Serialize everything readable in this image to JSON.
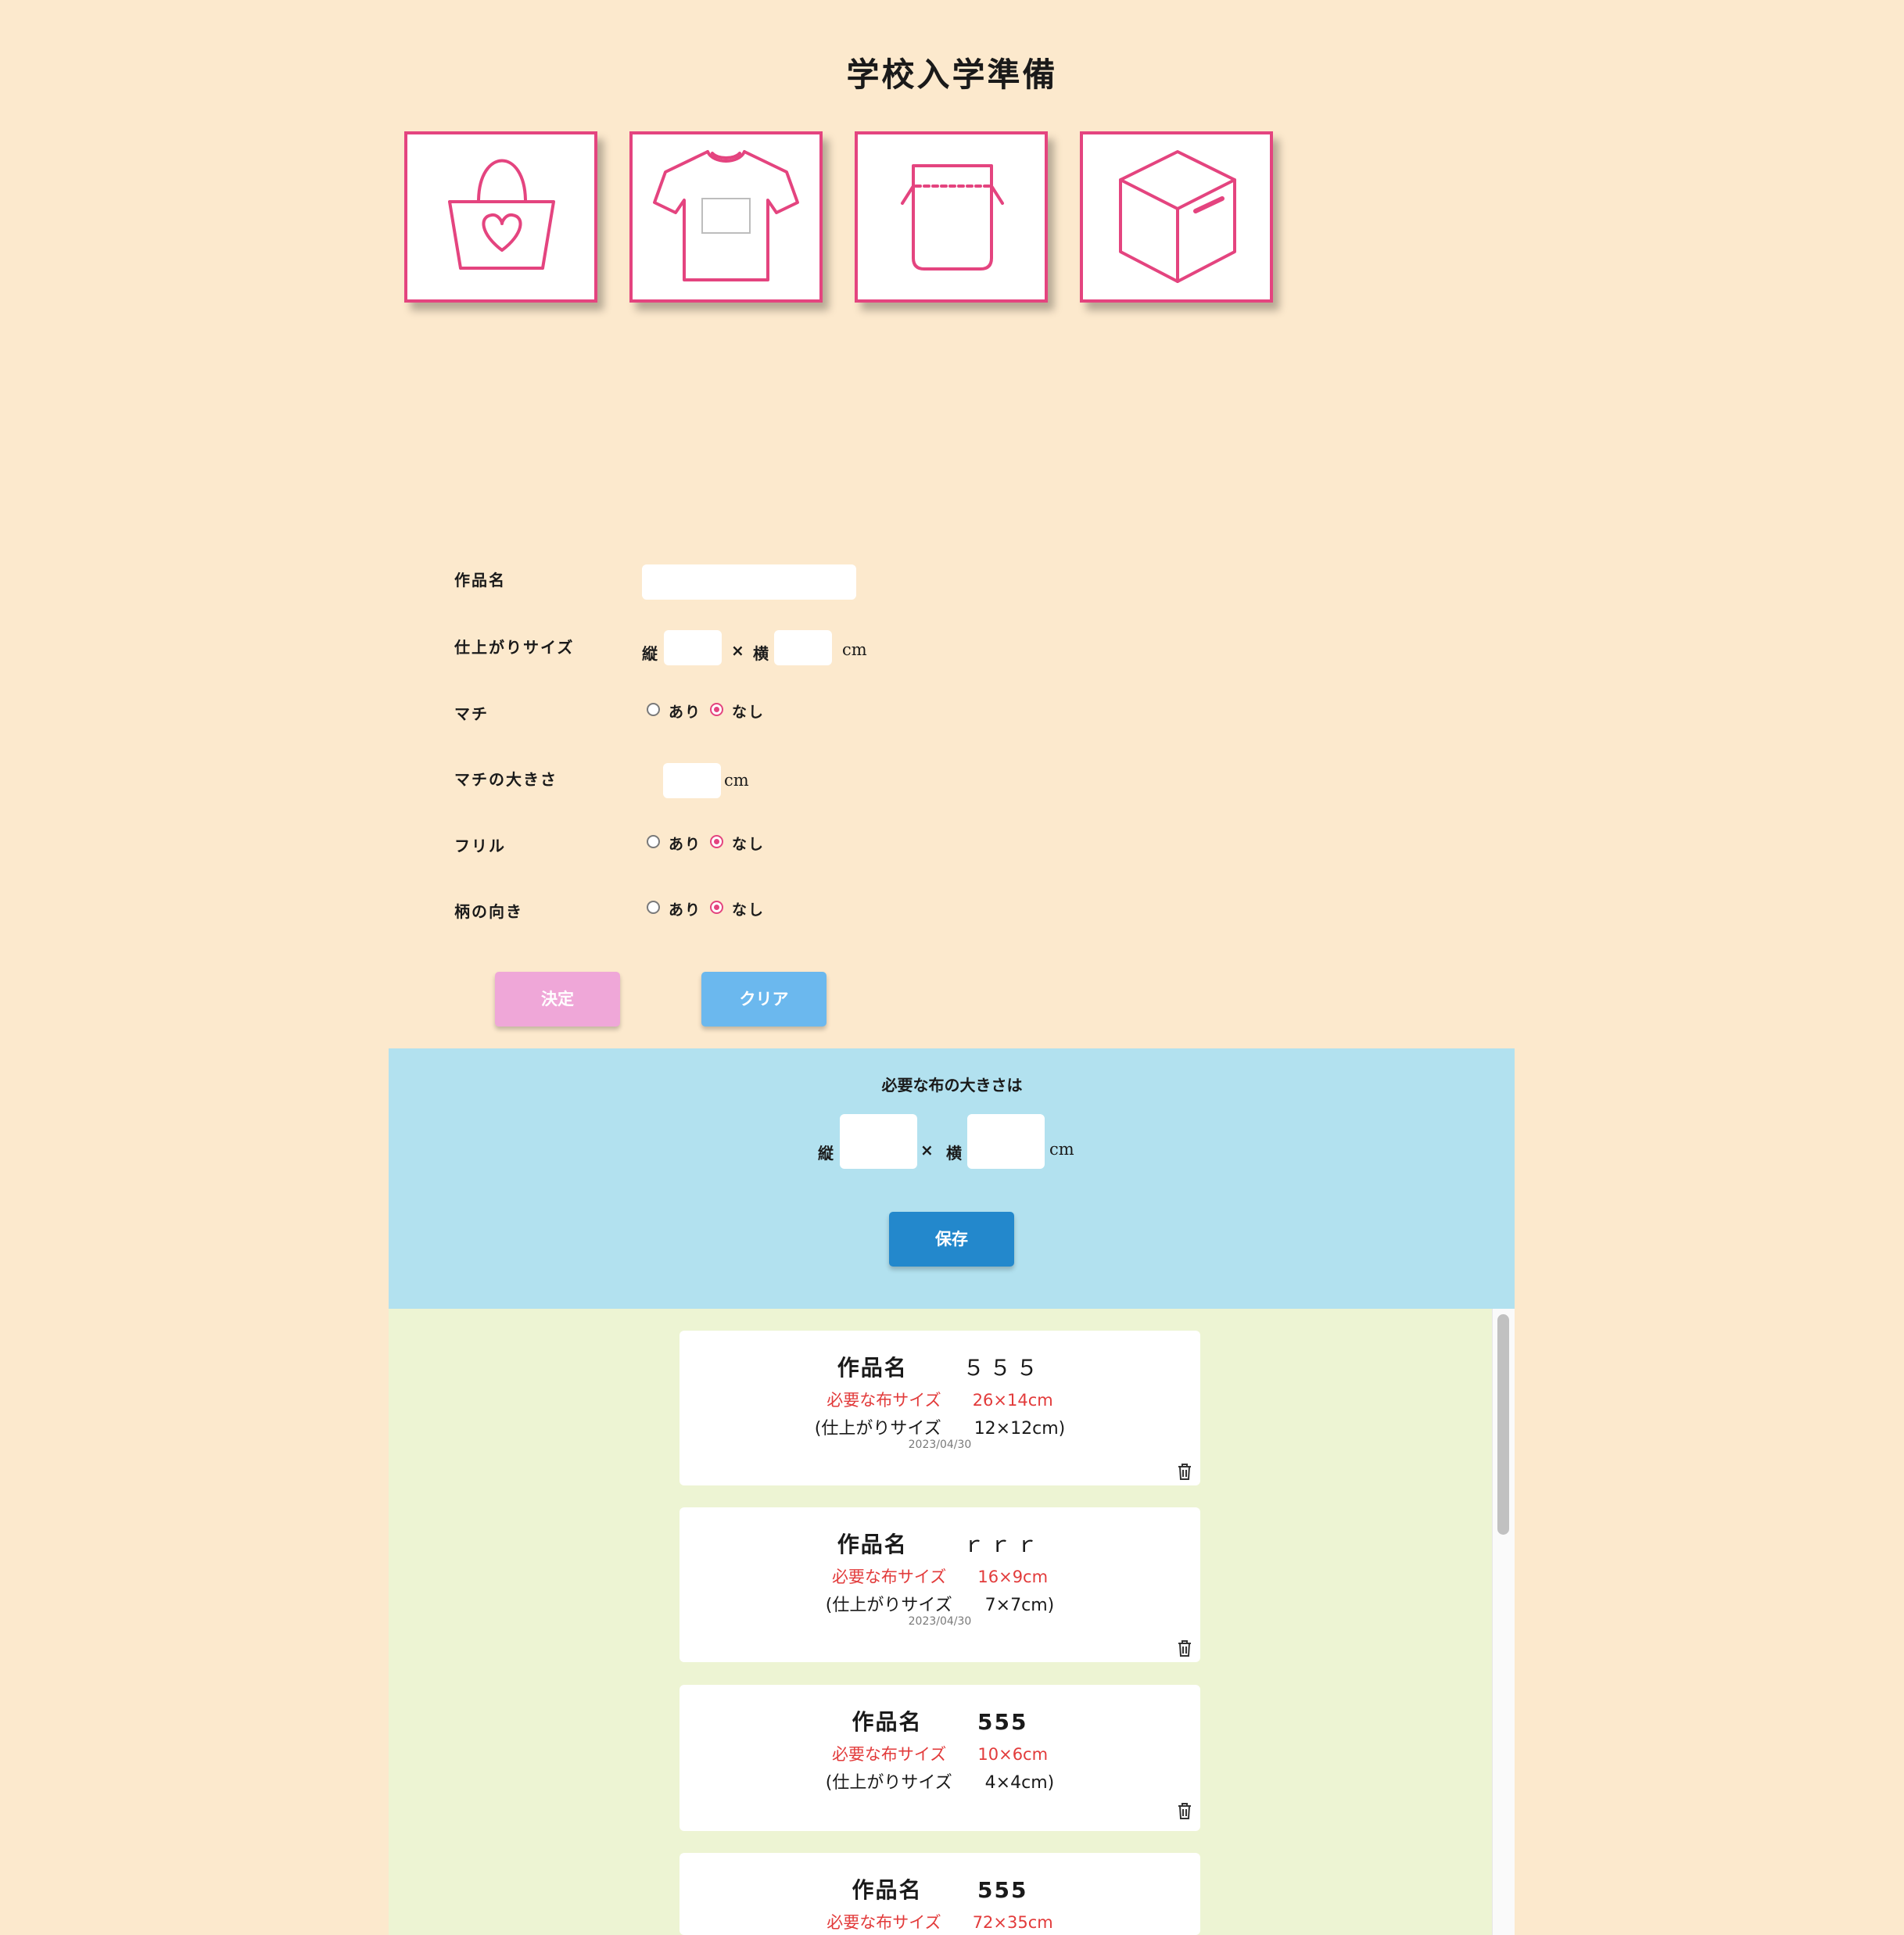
{
  "page_title": "学校入学準備",
  "icons": [
    {
      "name": "bag-icon"
    },
    {
      "name": "tshirt-icon"
    },
    {
      "name": "drawstring-pouch-icon"
    },
    {
      "name": "box-icon"
    }
  ],
  "form": {
    "name_label": "作品名",
    "name_value": "",
    "size_label": "仕上がりサイズ",
    "vertical": "縦",
    "times": "×",
    "horizontal": "横",
    "unit": "cm",
    "gusset_label": "マチ",
    "gusset_size_label": "マチの大きさ",
    "frill_label": "フリル",
    "pattern_label": "柄の向き",
    "yes": "あり",
    "no": "なし",
    "gusset_selected": "なし",
    "frill_selected": "なし",
    "pattern_selected": "なし"
  },
  "buttons": {
    "decide": "決定",
    "clear": "クリア",
    "save": "保存"
  },
  "result": {
    "heading": "必要な布の大きさは",
    "vertical": "縦",
    "times": "×",
    "horizontal": "横",
    "unit": "cm"
  },
  "records": [
    {
      "name_label": "作品名",
      "name": "５５５",
      "need_label": "必要な布サイズ",
      "need": "26×14cm",
      "finish_label": "(仕上がりサイズ",
      "finish": "12×12cm)",
      "date": "2023/04/30"
    },
    {
      "name_label": "作品名",
      "name": "ｒｒｒ",
      "need_label": "必要な布サイズ",
      "need": "16×9cm",
      "finish_label": "(仕上がりサイズ",
      "finish": "7×7cm)",
      "date": "2023/04/30"
    },
    {
      "name_label": "作品名",
      "name": "555",
      "need_label": "必要な布サイズ",
      "need": "10×6cm",
      "finish_label": "(仕上がりサイズ",
      "finish": "4×4cm)",
      "date": ""
    },
    {
      "name_label": "作品名",
      "name": "555",
      "need_label": "必要な布サイズ",
      "need": "72×35cm",
      "finish_label": "",
      "finish": "",
      "date": ""
    }
  ],
  "colors": {
    "background": "#fce9cd",
    "accent_pink": "#e4447f",
    "decide_button": "#efa7d8",
    "clear_button": "#6bb8ee",
    "save_button": "#2388cc",
    "result_panel": "#b2e1ef",
    "list_panel": "#edf4d3",
    "need_text": "#e23b3b"
  }
}
